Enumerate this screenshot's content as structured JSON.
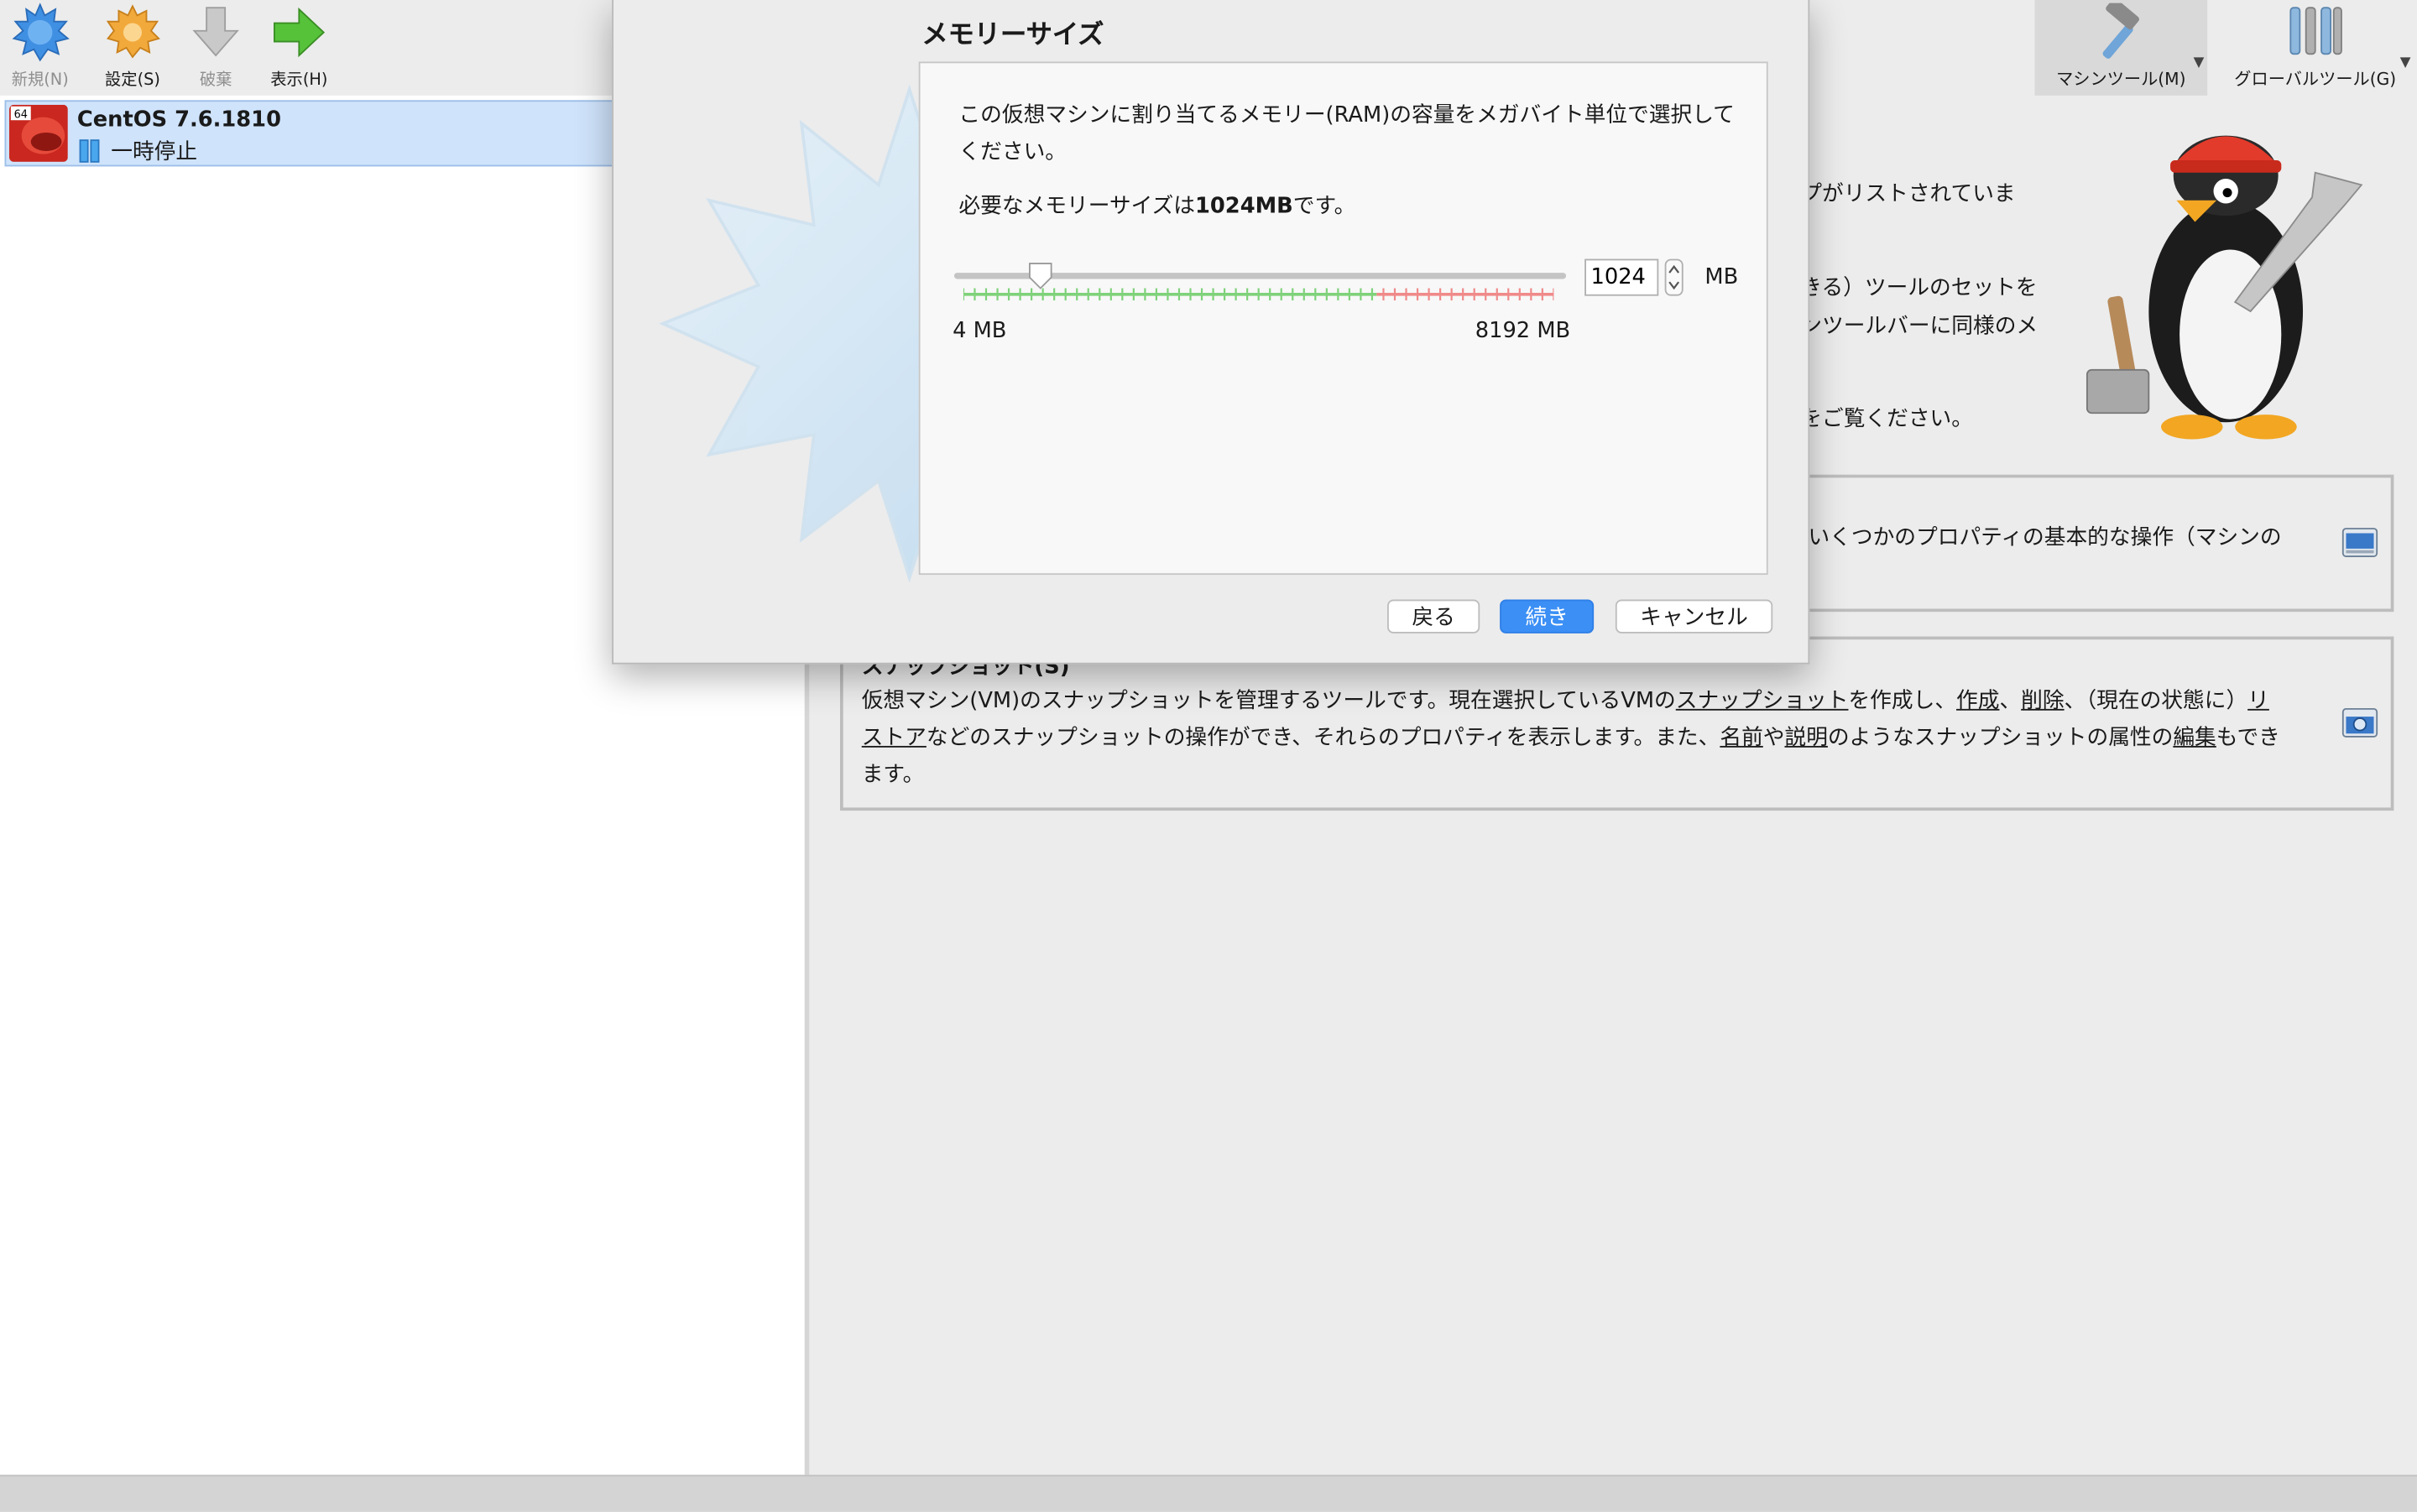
{
  "toolbar": {
    "new_label": "新規(N)",
    "settings_label": "設定(S)",
    "discard_label": "破棄",
    "show_label": "表示(H)"
  },
  "vm_list": {
    "items": [
      {
        "name": "CentOS 7.6.1810",
        "state": "一時停止",
        "badge": "64"
      }
    ]
  },
  "tools": {
    "machine_label": "マシンツール(M)",
    "global_label": "グローバルツール(G)"
  },
  "welcome": {
    "line1": "プがリストされていま",
    "line2": "きる）ツールのセットを",
    "line3": "ンツールバーに同様のメ",
    "line4": "をご覧ください。",
    "details_text": "いくつかのプロパティの基本的な操作（マシンの",
    "snapshots_title": "スナップショット(S)",
    "snap_p1": "仮想マシン(VM)のスナップショットを管理するツールです。現在選択しているVMの",
    "snap_link1": "スナップショット",
    "snap_p2": "を作成し、",
    "snap_link2": "作成",
    "snap_sep1": "、",
    "snap_link3": "削除",
    "snap_p3": "、（現在の状態に）",
    "snap_link4a": "リ",
    "snap_link4b": "ストア",
    "snap_p4": "などのスナップショットの操作ができ、それらのプロパティを表示します。また、",
    "snap_link5": "名前",
    "snap_p5": "や",
    "snap_link6": "説明",
    "snap_p6": "のようなスナップショットの属性の",
    "snap_link7": "編集",
    "snap_p7": "もでき",
    "snap_p8": "ます。"
  },
  "dialog": {
    "title": "メモリーサイズ",
    "description": "この仮想マシンに割り当てるメモリー(RAM)の容量をメガバイト単位で選択してください。",
    "required_prefix": "必要なメモリーサイズは",
    "required_value": "1024MB",
    "required_suffix": "です。",
    "slider": {
      "min": 4,
      "max": 8192,
      "value": 1024
    },
    "min_label": "4 MB",
    "max_label": "8192 MB",
    "input_value": "1024",
    "unit": "MB",
    "back_button": "戻る",
    "next_button": "続き",
    "cancel_button": "キャンセル"
  },
  "colors": {
    "accent": "#3b8ff5",
    "selection": "#cfe3fb",
    "tick_green": "#7fd27a",
    "tick_red": "#f08a8a"
  }
}
